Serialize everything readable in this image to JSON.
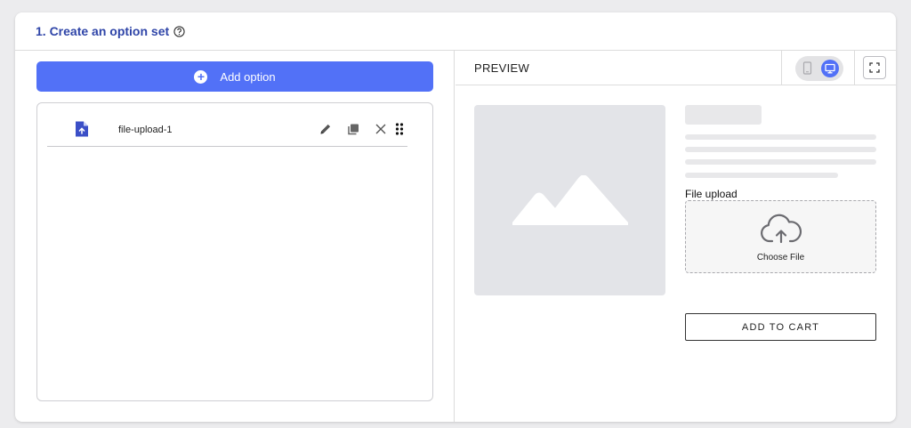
{
  "section": {
    "title": "1. Create an option set",
    "help_icon": "help-circle-icon"
  },
  "options_panel": {
    "add_option_label": "Add option",
    "add_icon": "plus-circle-icon",
    "options": [
      {
        "label": "file-upload-1",
        "icon": "file-upload-icon",
        "actions": [
          "edit-pencil-icon",
          "duplicate-icon",
          "delete-x-icon",
          "drag-handle-icon"
        ]
      }
    ]
  },
  "preview": {
    "title": "PREVIEW",
    "device_modes": [
      "mobile",
      "desktop"
    ],
    "active_device": "desktop",
    "fullscreen_icon": "fullscreen-icon",
    "image_icon": "image-placeholder-icon",
    "file_upload_label": "File upload",
    "choose_file_label": "Choose File",
    "upload_icon": "cloud-upload-icon",
    "add_to_cart_label": "ADD TO CART"
  },
  "colors": {
    "accent": "#5271f7",
    "title": "#2f45a8",
    "file_icon": "#3b4fc7"
  }
}
